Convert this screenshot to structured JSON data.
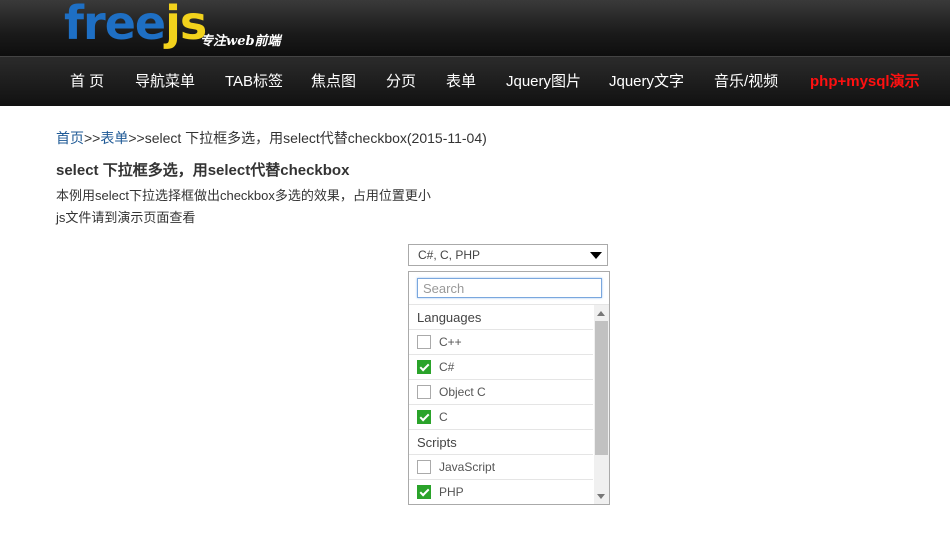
{
  "brand": {
    "logo_free": "free",
    "logo_js": "js",
    "tagline": "专注web前端"
  },
  "nav": {
    "items": [
      {
        "label": "首 页"
      },
      {
        "label": "导航菜单"
      },
      {
        "label": "TAB标签"
      },
      {
        "label": "焦点图"
      },
      {
        "label": "分页"
      },
      {
        "label": "表单"
      },
      {
        "label": "Jquery图片"
      },
      {
        "label": "Jquery文字"
      },
      {
        "label": "音乐/视频"
      },
      {
        "label": "php+mysql演示"
      }
    ],
    "hot_color": "#ff1010"
  },
  "breadcrumb": {
    "home": "首页",
    "sep1": ">>",
    "category": "表单",
    "sep2": ">>",
    "current": "select 下拉框多选，用select代替checkbox(2015-11-04)"
  },
  "article": {
    "title": "select 下拉框多选，用select代替checkbox",
    "desc1": "本例用select下拉选择框做出checkbox多选的效果，占用位置更小",
    "desc2": "js文件请到演示页面查看"
  },
  "select": {
    "value": "C#, C, PHP",
    "search_placeholder": "Search",
    "groups": [
      {
        "label": "Languages"
      },
      {
        "label": "Scripts"
      }
    ],
    "options": [
      {
        "label": "C++",
        "checked": false
      },
      {
        "label": "C#",
        "checked": true
      },
      {
        "label": "Object C",
        "checked": false
      },
      {
        "label": "C",
        "checked": true
      },
      {
        "label": "JavaScript",
        "checked": false
      },
      {
        "label": "PHP",
        "checked": true
      }
    ],
    "check_color": "#2aa32a"
  }
}
